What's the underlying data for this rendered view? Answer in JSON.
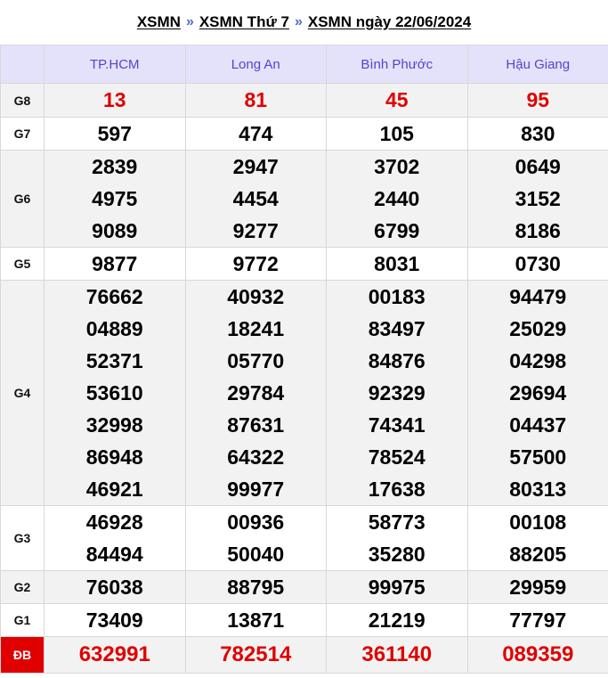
{
  "breadcrumb": {
    "link1": "XSMN",
    "link2": "XSMN Thứ 7",
    "link3": "XSMN ngày 22/06/2024",
    "separator": "»"
  },
  "provinces": [
    "TP.HCM",
    "Long An",
    "Bình Phước",
    "Hậu Giang"
  ],
  "prizes": {
    "g8": {
      "label": "G8",
      "values": [
        [
          "13"
        ],
        [
          "81"
        ],
        [
          "45"
        ],
        [
          "95"
        ]
      ]
    },
    "g7": {
      "label": "G7",
      "values": [
        [
          "597"
        ],
        [
          "474"
        ],
        [
          "105"
        ],
        [
          "830"
        ]
      ]
    },
    "g6": {
      "label": "G6",
      "values": [
        [
          "2839",
          "4975",
          "9089"
        ],
        [
          "2947",
          "4454",
          "9277"
        ],
        [
          "3702",
          "2440",
          "6799"
        ],
        [
          "0649",
          "3152",
          "8186"
        ]
      ]
    },
    "g5": {
      "label": "G5",
      "values": [
        [
          "9877"
        ],
        [
          "9772"
        ],
        [
          "8031"
        ],
        [
          "0730"
        ]
      ]
    },
    "g4": {
      "label": "G4",
      "values": [
        [
          "76662",
          "04889",
          "52371",
          "53610",
          "32998",
          "86948",
          "46921"
        ],
        [
          "40932",
          "18241",
          "05770",
          "29784",
          "87631",
          "64322",
          "99977"
        ],
        [
          "00183",
          "83497",
          "84876",
          "92329",
          "74341",
          "78524",
          "17638"
        ],
        [
          "94479",
          "25029",
          "04298",
          "29694",
          "04437",
          "57500",
          "80313"
        ]
      ]
    },
    "g3": {
      "label": "G3",
      "values": [
        [
          "46928",
          "84494"
        ],
        [
          "00936",
          "50040"
        ],
        [
          "58773",
          "35280"
        ],
        [
          "00108",
          "88205"
        ]
      ]
    },
    "g2": {
      "label": "G2",
      "values": [
        [
          "76038"
        ],
        [
          "88795"
        ],
        [
          "99975"
        ],
        [
          "29959"
        ]
      ]
    },
    "g1": {
      "label": "G1",
      "values": [
        [
          "73409"
        ],
        [
          "13871"
        ],
        [
          "21219"
        ],
        [
          "77797"
        ]
      ]
    },
    "db": {
      "label": "ĐB",
      "values": [
        [
          "632991"
        ],
        [
          "782514"
        ],
        [
          "361140"
        ],
        [
          "089359"
        ]
      ]
    }
  },
  "colors": {
    "header_bg": "#e4e2fb",
    "header_text": "#5a3fd0",
    "highlight_red": "#e00000",
    "row_shade": "#f2f2f2"
  }
}
